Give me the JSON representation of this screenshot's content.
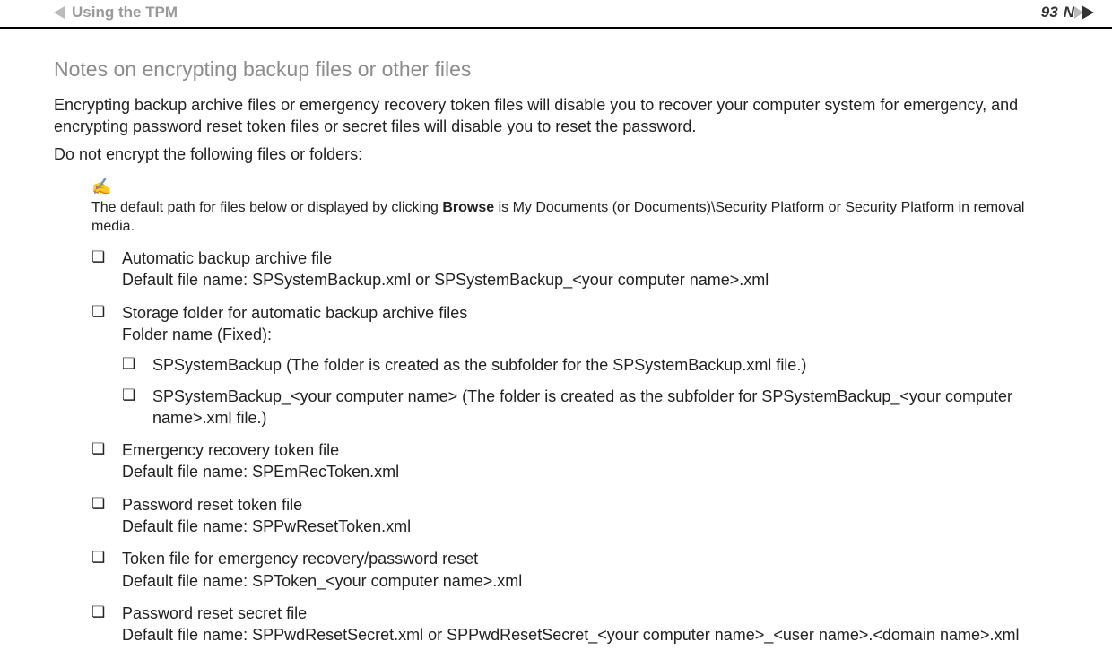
{
  "header": {
    "breadcrumb": "Using the TPM",
    "page_number": "93",
    "nav_label": "N"
  },
  "section": {
    "title": "Notes on encrypting backup files or other files",
    "intro1": "Encrypting backup archive files or emergency recovery token files will disable you to recover your computer system for emergency, and encrypting password reset token files or secret files will disable you to reset the password.",
    "intro2": "Do not encrypt the following files or folders:",
    "note_icon": "✍",
    "note_pre": "The default path for files below or displayed by clicking ",
    "note_bold": "Browse",
    "note_post": " is My Documents (or Documents)\\Security Platform or Security Platform in removal media."
  },
  "items": [
    {
      "title": "Automatic backup archive file",
      "sub": "Default file name: SPSystemBackup.xml or SPSystemBackup_<your computer name>.xml"
    },
    {
      "title": "Storage folder for automatic backup archive files",
      "sub": "Folder name (Fixed):",
      "children": [
        "SPSystemBackup (The folder is created as the subfolder for the SPSystemBackup.xml file.)",
        "SPSystemBackup_<your computer name> (The folder is created as the subfolder for SPSystemBackup_<your computer name>.xml file.)"
      ]
    },
    {
      "title": "Emergency recovery token file",
      "sub": "Default file name: SPEmRecToken.xml"
    },
    {
      "title": "Password reset token file",
      "sub": "Default file name: SPPwResetToken.xml"
    },
    {
      "title": "Token file for emergency recovery/password reset",
      "sub": "Default file name: SPToken_<your computer name>.xml"
    },
    {
      "title": "Password reset secret file",
      "sub": "Default file name: SPPwdResetSecret.xml or SPPwdResetSecret_<your computer name>_<user name>.<domain name>.xml"
    }
  ]
}
